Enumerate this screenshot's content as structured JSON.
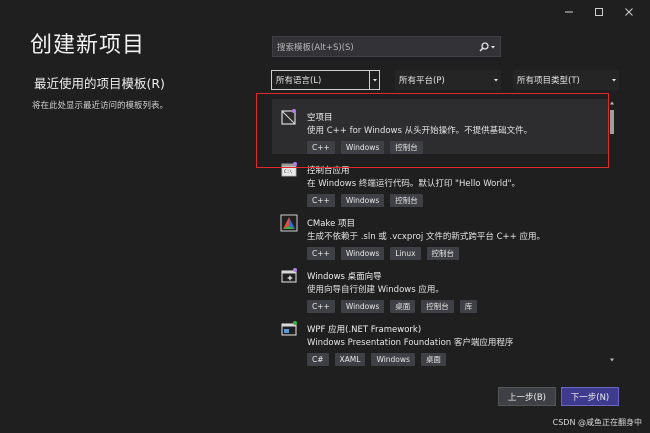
{
  "window": {
    "caption": {
      "minimize_icon": "minimize-icon",
      "maximize_icon": "maximize-icon",
      "close_icon": "close-icon"
    }
  },
  "title": "创建新项目",
  "recent": {
    "heading": "最近使用的项目模板(R)",
    "empty_text": "将在此处显示最近访问的模板列表。"
  },
  "search": {
    "placeholder": "搜索模板(Alt+S)(S)",
    "icon": "search-icon"
  },
  "filters": {
    "language": "所有语言(L)",
    "platform": "所有平台(P)",
    "project_type": "所有项目类型(T)"
  },
  "templates": [
    {
      "name": "空项目",
      "desc": "使用 C++ for Windows 从头开始操作。不提供基础文件。",
      "tags": [
        "C++",
        "Windows",
        "控制台"
      ],
      "icon": "empty-project-icon",
      "selected": true
    },
    {
      "name": "控制台应用",
      "desc": "在 Windows 终端运行代码。默认打印 \"Hello World\"。",
      "tags": [
        "C++",
        "Windows",
        "控制台"
      ],
      "icon": "console-app-icon",
      "selected": false
    },
    {
      "name": "CMake 项目",
      "desc": "生成不依赖于 .sln 或 .vcxproj 文件的新式跨平台 C++ 应用。",
      "tags": [
        "C++",
        "Windows",
        "Linux",
        "控制台"
      ],
      "icon": "cmake-icon",
      "selected": false
    },
    {
      "name": "Windows 桌面向导",
      "desc": "使用向导自行创建 Windows 应用。",
      "tags": [
        "C++",
        "Windows",
        "桌面",
        "控制台",
        "库"
      ],
      "icon": "desktop-wizard-icon",
      "selected": false
    },
    {
      "name": "WPF 应用(.NET Framework)",
      "desc": "Windows Presentation Foundation 客户端应用程序",
      "tags": [
        "C#",
        "XAML",
        "Windows",
        "桌面"
      ],
      "icon": "wpf-icon",
      "selected": false
    }
  ],
  "buttons": {
    "prev": "上一步(B)",
    "next": "下一步(N)"
  },
  "watermark": "CSDN @咸鱼正在翻身中",
  "colors": {
    "background": "#1f1f1f",
    "highlight": "#e0282d",
    "primary_button": "#3e3a8e",
    "tag": "#3f3f46"
  }
}
